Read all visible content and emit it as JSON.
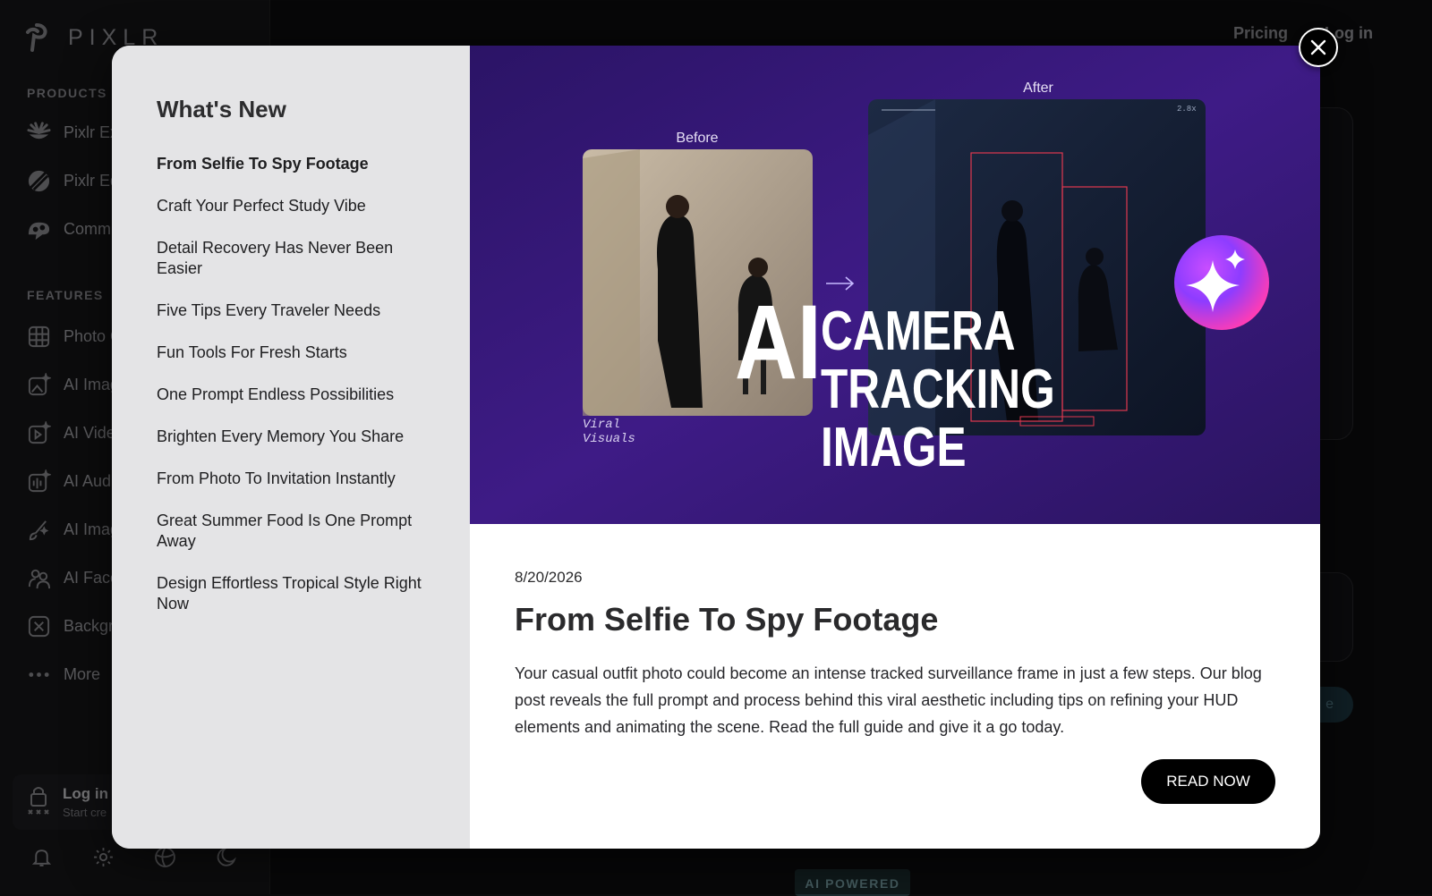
{
  "app": {
    "logo_text": "PIXLR",
    "topbar": {
      "pricing": "Pricing",
      "login": "Log in"
    },
    "sidebar": {
      "products_label": "PRODUCTS",
      "products": [
        {
          "label": "Pixlr Ex",
          "icon": "pixlr-express-icon"
        },
        {
          "label": "Pixlr Ed",
          "icon": "pixlr-editor-icon"
        },
        {
          "label": "Comm",
          "icon": "community-icon"
        }
      ],
      "features_label": "FEATURES",
      "features": [
        {
          "label": "Photo C",
          "icon": "grid-icon"
        },
        {
          "label": "AI Imag",
          "icon": "ai-image-icon"
        },
        {
          "label": "AI Vide",
          "icon": "ai-video-icon"
        },
        {
          "label": "AI Audi",
          "icon": "ai-audio-icon"
        },
        {
          "label": "AI Imag",
          "icon": "ai-brush-icon"
        },
        {
          "label": "AI Face",
          "icon": "ai-face-icon"
        },
        {
          "label": "Backgr",
          "icon": "background-icon"
        },
        {
          "label": "More",
          "icon": "more-icon"
        }
      ],
      "login": {
        "title": "Log in",
        "subtitle": "Start cre"
      }
    },
    "badge": "AI POWERED",
    "pill_text": "e"
  },
  "modal": {
    "heading": "What's New",
    "items": [
      "From Selfie To Spy Footage",
      "Craft Your Perfect Study Vibe",
      "Detail Recovery Has Never Been Easier",
      "Five Tips Every Traveler Needs",
      "Fun Tools For Fresh Starts",
      "One Prompt Endless Possibilities",
      "Brighten Every Memory You Share",
      "From Photo To Invitation Instantly",
      "Great Summer Food Is One Prompt Away",
      "Design Effortless Tropical Style Right Now"
    ],
    "active_index": 0,
    "hero": {
      "before_label": "Before",
      "after_label": "After",
      "ai_text": "AI",
      "line1": "CAMERA",
      "line2": "TRACKING",
      "line3": "IMAGE",
      "caption_line1": "Viral",
      "caption_line2": "Visuals"
    },
    "article": {
      "date": "8/20/2026",
      "title": "From Selfie To Spy Footage",
      "body": "Your casual outfit photo could become an intense tracked surveillance frame in just a few steps. Our blog post reveals the full prompt and process behind this viral aesthetic including tips on refining your HUD elements and animating the scene. Read the full guide and give it a go today.",
      "button": "READ NOW"
    }
  }
}
